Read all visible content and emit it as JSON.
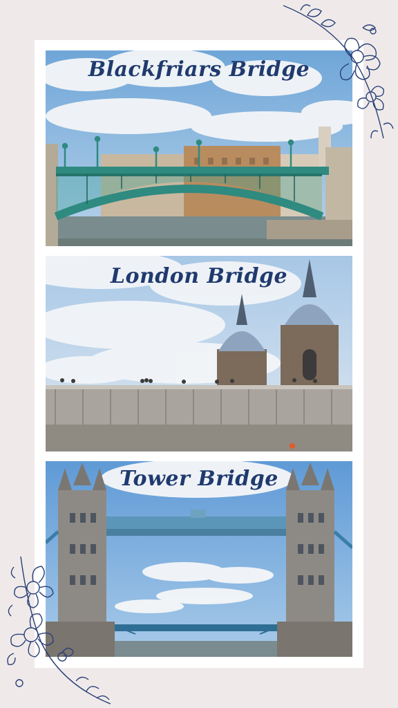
{
  "photos": [
    {
      "title": "Blackfriars Bridge"
    },
    {
      "title": "London Bridge"
    },
    {
      "title": "Tower Bridge"
    }
  ],
  "colors": {
    "background": "#efeae9",
    "frame": "#ffffff",
    "title_ink": "#1f3a6e",
    "floral_ink": "#2a3f78",
    "sky": "#9fc4e6",
    "bridge_green": "#2f8a80"
  },
  "decorations": {
    "top_right": "floral-sketch",
    "bottom_left": "floral-sketch"
  }
}
